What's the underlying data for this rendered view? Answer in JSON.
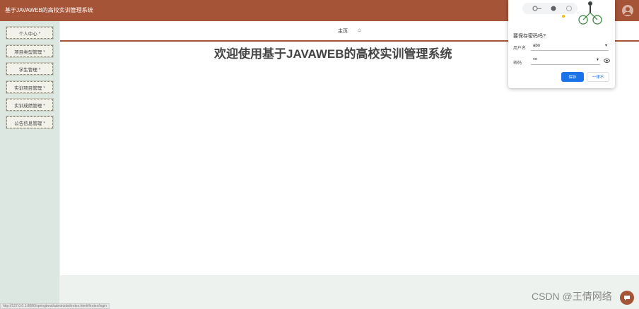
{
  "header": {
    "title": "基于JAVAWEB的高校实训管理系统"
  },
  "sidebar": {
    "items": [
      {
        "label": "个人中心"
      },
      {
        "label": "项目类型管理"
      },
      {
        "label": "学生管理"
      },
      {
        "label": "实训项目管理"
      },
      {
        "label": "实训成绩管理"
      },
      {
        "label": "公告信息管理"
      }
    ],
    "caret": "▾"
  },
  "breadcrumb": {
    "home": "主页",
    "home_icon": "⌂"
  },
  "main": {
    "welcome": "欢迎使用基于JAVAWEB的高校实训管理系统"
  },
  "save_password_popup": {
    "question": "要保存密码吗?",
    "username_label": "用户名",
    "username_value": "abo",
    "password_label": "密码",
    "password_value": "•••",
    "save_label": "保存",
    "never_label": "一律不"
  },
  "status_bar": {
    "url": "http://127.0.0.1:8080/springboot/admin/dist/index.html#/index/login"
  },
  "watermark": "CSDN @王倩网络",
  "colors": {
    "header": "#a65437",
    "sidebar": "#dde7e2",
    "primary_button": "#1a73e8"
  }
}
